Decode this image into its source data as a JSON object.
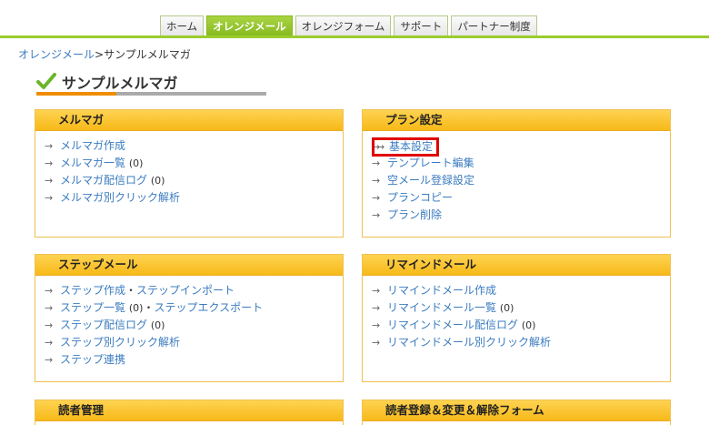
{
  "nav": {
    "tabs": [
      {
        "label": "ホーム",
        "active": false
      },
      {
        "label": "オレンジメール",
        "active": true
      },
      {
        "label": "オレンジフォーム",
        "active": false
      },
      {
        "label": "サポート",
        "active": false
      },
      {
        "label": "パートナー制度",
        "active": false
      }
    ]
  },
  "breadcrumb": {
    "root": "オレンジメール",
    "separator": ">",
    "current": "サンプルメルマガ"
  },
  "page_title": "サンプルメルマガ",
  "panels": {
    "mailmag": {
      "title": "メルマガ",
      "items": [
        {
          "label": "メルマガ作成"
        },
        {
          "label": "メルマガ一覧",
          "count": "(0)"
        },
        {
          "label": "メルマガ配信ログ",
          "count": "(0)"
        },
        {
          "label": "メルマガ別クリック解析"
        }
      ]
    },
    "plan": {
      "title": "プラン設定",
      "items": [
        {
          "label": "基本設定",
          "highlighted": true
        },
        {
          "label": "テンプレート編集"
        },
        {
          "label": "空メール登録設定"
        },
        {
          "label": "プランコピー"
        },
        {
          "label": "プラン削除"
        }
      ]
    },
    "step": {
      "title": "ステップメール",
      "items": [
        {
          "label": "ステップ作成",
          "sep": "・",
          "label2": "ステップインポート"
        },
        {
          "label": "ステップ一覧",
          "count": "(0)",
          "sep": "・",
          "label2": "ステップエクスポート"
        },
        {
          "label": "ステップ配信ログ",
          "count": "(0)"
        },
        {
          "label": "ステップ別クリック解析"
        },
        {
          "label": "ステップ連携"
        }
      ]
    },
    "remind": {
      "title": "リマインドメール",
      "items": [
        {
          "label": "リマインドメール作成"
        },
        {
          "label": "リマインドメール一覧",
          "count": "(0)"
        },
        {
          "label": "リマインドメール配信ログ",
          "count": "(0)"
        },
        {
          "label": "リマインドメール別クリック解析"
        }
      ]
    },
    "readers": {
      "title": "読者管理"
    },
    "forms": {
      "title": "読者登録＆変更＆解除フォーム"
    }
  },
  "arrow_glyph": "→",
  "colors": {
    "accent_green": "#9ccc2e",
    "accent_orange": "#f08c00",
    "link": "#3b7cc0",
    "panel_head": "#f7b918",
    "highlight": "#e00000"
  }
}
